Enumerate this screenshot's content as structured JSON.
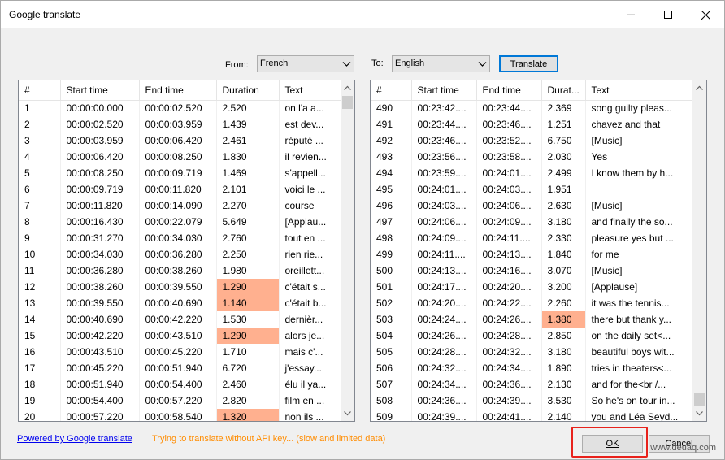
{
  "window": {
    "title": "Google translate"
  },
  "from": {
    "label": "From:",
    "value": "French"
  },
  "to": {
    "label": "To:",
    "value": "English"
  },
  "translate_button": "Translate",
  "source_grid": {
    "columns": [
      "#",
      "Start time",
      "End time",
      "Duration",
      "Text"
    ],
    "rows": [
      [
        "1",
        "00:00:00.000",
        "00:00:02.520",
        "2.520",
        "on l'a a..."
      ],
      [
        "2",
        "00:00:02.520",
        "00:00:03.959",
        "1.439",
        "est dev..."
      ],
      [
        "3",
        "00:00:03.959",
        "00:00:06.420",
        "2.461",
        "réputé ..."
      ],
      [
        "4",
        "00:00:06.420",
        "00:00:08.250",
        "1.830",
        "il revien..."
      ],
      [
        "5",
        "00:00:08.250",
        "00:00:09.719",
        "1.469",
        "s'appell..."
      ],
      [
        "6",
        "00:00:09.719",
        "00:00:11.820",
        "2.101",
        "voici le ..."
      ],
      [
        "7",
        "00:00:11.820",
        "00:00:14.090",
        "2.270",
        "course"
      ],
      [
        "8",
        "00:00:16.430",
        "00:00:22.079",
        "5.649",
        "[Applau..."
      ],
      [
        "9",
        "00:00:31.270",
        "00:00:34.030",
        "2.760",
        "tout en ..."
      ],
      [
        "10",
        "00:00:34.030",
        "00:00:36.280",
        "2.250",
        "rien rie..."
      ],
      [
        "11",
        "00:00:36.280",
        "00:00:38.260",
        "1.980",
        "oreillett..."
      ],
      [
        "12",
        "00:00:38.260",
        "00:00:39.550",
        "1.290",
        "c'était s..."
      ],
      [
        "13",
        "00:00:39.550",
        "00:00:40.690",
        "1.140",
        "c'était b..."
      ],
      [
        "14",
        "00:00:40.690",
        "00:00:42.220",
        "1.530",
        "dernièr..."
      ],
      [
        "15",
        "00:00:42.220",
        "00:00:43.510",
        "1.290",
        "alors je..."
      ],
      [
        "16",
        "00:00:43.510",
        "00:00:45.220",
        "1.710",
        "mais c'..."
      ],
      [
        "17",
        "00:00:45.220",
        "00:00:51.940",
        "6.720",
        "j'essay..."
      ],
      [
        "18",
        "00:00:51.940",
        "00:00:54.400",
        "2.460",
        "élu il ya..."
      ],
      [
        "19",
        "00:00:54.400",
        "00:00:57.220",
        "2.820",
        "film en ..."
      ],
      [
        "20",
        "00:00:57.220",
        "00:00:58.540",
        "1.320",
        "non ils ..."
      ]
    ],
    "highlighted_rows": [
      11,
      12,
      14,
      19
    ]
  },
  "target_grid": {
    "columns": [
      "#",
      "Start time",
      "End time",
      "Durat...",
      "Text"
    ],
    "rows": [
      [
        "490",
        "00:23:42....",
        "00:23:44....",
        "2.369",
        "song guilty pleas..."
      ],
      [
        "491",
        "00:23:44....",
        "00:23:46....",
        "1.251",
        "chavez and that"
      ],
      [
        "492",
        "00:23:46....",
        "00:23:52....",
        "6.750",
        "[Music]"
      ],
      [
        "493",
        "00:23:56....",
        "00:23:58....",
        "2.030",
        "Yes"
      ],
      [
        "494",
        "00:23:59....",
        "00:24:01....",
        "2.499",
        "I know them by h..."
      ],
      [
        "495",
        "00:24:01....",
        "00:24:03....",
        "1.951",
        ""
      ],
      [
        "496",
        "00:24:03....",
        "00:24:06....",
        "2.630",
        "[Music]"
      ],
      [
        "497",
        "00:24:06....",
        "00:24:09....",
        "3.180",
        "and finally the so..."
      ],
      [
        "498",
        "00:24:09....",
        "00:24:11....",
        "2.330",
        "pleasure yes but ..."
      ],
      [
        "499",
        "00:24:11....",
        "00:24:13....",
        "1.840",
        "for me"
      ],
      [
        "500",
        "00:24:13....",
        "00:24:16....",
        "3.070",
        "[Music]"
      ],
      [
        "501",
        "00:24:17....",
        "00:24:20....",
        "3.200",
        "[Applause]"
      ],
      [
        "502",
        "00:24:20....",
        "00:24:22....",
        "2.260",
        "it was the tennis..."
      ],
      [
        "503",
        "00:24:24....",
        "00:24:26....",
        "1.380",
        "there but thank y..."
      ],
      [
        "504",
        "00:24:26....",
        "00:24:28....",
        "2.850",
        "on the daily set<..."
      ],
      [
        "505",
        "00:24:28....",
        "00:24:32....",
        "3.180",
        "beautiful boys wit..."
      ],
      [
        "506",
        "00:24:32....",
        "00:24:34....",
        "1.890",
        "tries in theaters<..."
      ],
      [
        "507",
        "00:24:34....",
        "00:24:36....",
        "2.130",
        "and for the<br /..."
      ],
      [
        "508",
        "00:24:36....",
        "00:24:39....",
        "3.530",
        "So he's on tour in..."
      ],
      [
        "509",
        "00:24:39....",
        "00:24:41....",
        "2.140",
        "you and Léa Seyd..."
      ]
    ],
    "highlighted_rows": [
      13
    ]
  },
  "footer": {
    "link": "Powered by Google translate",
    "warning": "Trying to translate without API key... (slow and limited data)",
    "ok": "OK",
    "cancel": "Cancel"
  },
  "watermark": "www.deuaq.com",
  "colors": {
    "highlight": "#ffb08f",
    "warning": "#ff8c00",
    "link": "#0000ee",
    "annotation": "#e8221c",
    "focus": "#0078d7"
  }
}
